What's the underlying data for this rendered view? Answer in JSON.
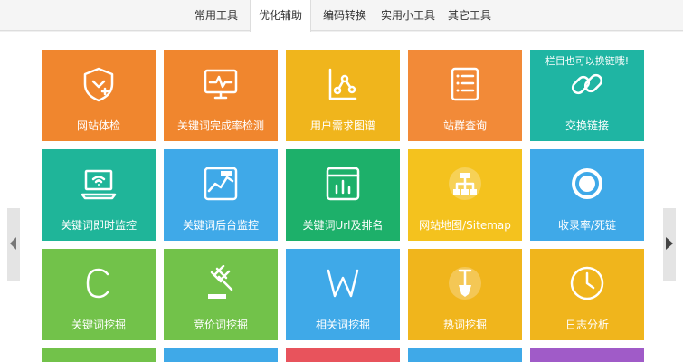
{
  "tabs": [
    {
      "label": "常用工具"
    },
    {
      "label": "优化辅助"
    },
    {
      "label": "编码转换"
    },
    {
      "label": "实用小工具"
    },
    {
      "label": "其它工具"
    }
  ],
  "active_tab": 1,
  "tiles": [
    {
      "label": "网站体检",
      "color": "#f0862e",
      "icon": "shield-heart-icon"
    },
    {
      "label": "关键词完成率检测",
      "color": "#f0862e",
      "icon": "monitor-pulse-icon"
    },
    {
      "label": "用户需求图谱",
      "color": "#f0b51c",
      "icon": "share-graph-icon"
    },
    {
      "label": "站群查询",
      "color": "#f28a38",
      "icon": "list-icon"
    },
    {
      "label": "交换链接",
      "color": "#1fb5a3",
      "icon": "chain-link-icon",
      "badge": "栏目也可以换链哦!"
    },
    {
      "label": "关键词即时监控",
      "color": "#1fb599",
      "icon": "laptop-wifi-icon"
    },
    {
      "label": "关键词后台监控",
      "color": "#3fa9e8",
      "icon": "line-chart-icon"
    },
    {
      "label": "关键词Url及排名",
      "color": "#1db06a",
      "icon": "bar-chart-icon"
    },
    {
      "label": "网站地图/Sitemap",
      "color": "#f4c21e",
      "icon": "sitemap-icon"
    },
    {
      "label": "收录率/死链",
      "color": "#3fa9e8",
      "icon": "ring-icon"
    },
    {
      "label": "关键词挖掘",
      "color": "#72c24a",
      "icon": "c-letter-icon"
    },
    {
      "label": "竞价词挖掘",
      "color": "#72c24a",
      "icon": "auction-hammer-icon"
    },
    {
      "label": "相关词挖掘",
      "color": "#3fa9e8",
      "icon": "w-letter-icon"
    },
    {
      "label": "热词挖掘",
      "color": "#f0b51c",
      "icon": "shovel-icon"
    },
    {
      "label": "日志分析",
      "color": "#f0b51c",
      "icon": "clock-icon"
    }
  ],
  "partial_row_colors": [
    "#72c24a",
    "#3fa9e8",
    "#e8535c",
    "#3fa9e8",
    "#a05bc8"
  ],
  "nav": {
    "prev_icon": "chevron-left-icon",
    "next_icon": "chevron-right-icon"
  }
}
